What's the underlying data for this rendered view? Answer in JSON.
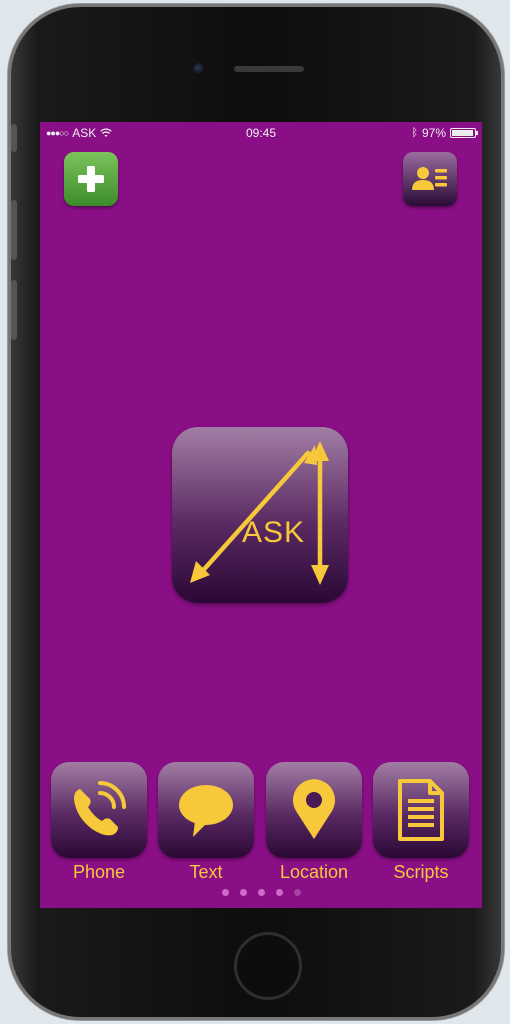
{
  "status_bar": {
    "carrier": "ASK",
    "time": "09:45",
    "battery_percent": "97%",
    "battery_level": 0.97
  },
  "toolbar": {
    "add_icon": "plus-icon",
    "contacts_icon": "contact-card-icon"
  },
  "logo": {
    "text": "ASK",
    "icon": "ask-arrows-logo"
  },
  "dock": {
    "items": [
      {
        "label": "Phone",
        "icon": "phone-icon"
      },
      {
        "label": "Text",
        "icon": "speech-bubble-icon"
      },
      {
        "label": "Location",
        "icon": "map-pin-icon"
      },
      {
        "label": "Scripts",
        "icon": "document-icon"
      }
    ]
  },
  "page_indicator": {
    "total": 5,
    "active": 0
  },
  "colors": {
    "background": "#8a0f86",
    "accent": "#f7c83a",
    "add_button": "#4fa339"
  }
}
